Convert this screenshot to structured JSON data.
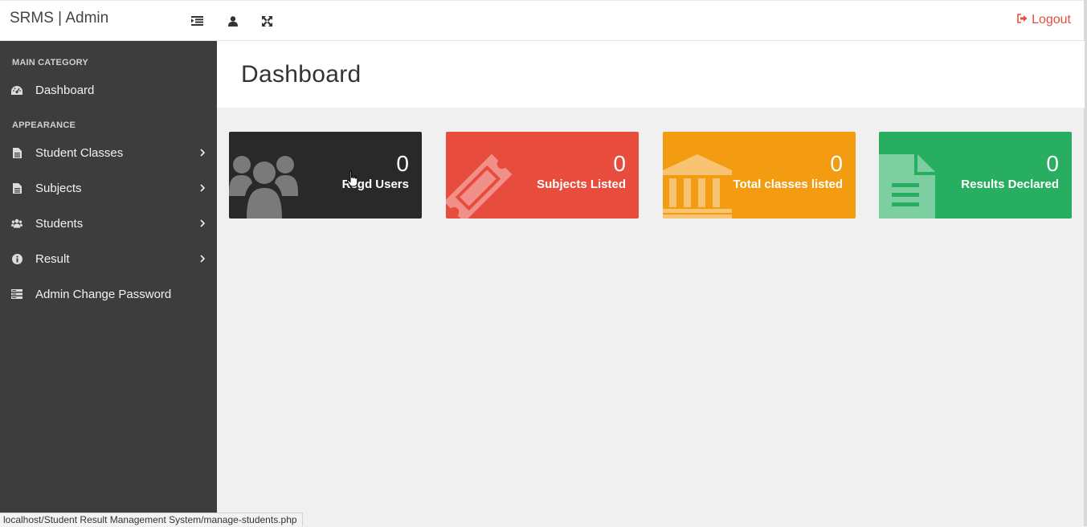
{
  "header": {
    "brand": "SRMS | Admin",
    "logout_label": "Logout",
    "icons": [
      "list-indent-icon",
      "user-icon",
      "expand-icon"
    ]
  },
  "sidebar": {
    "categories": [
      "MAIN CATEGORY",
      "APPEARANCE"
    ],
    "items": [
      {
        "label": "Dashboard",
        "icon": "dashboard-icon"
      },
      {
        "label": "Student Classes",
        "icon": "file-icon"
      },
      {
        "label": "Subjects",
        "icon": "file-icon"
      },
      {
        "label": "Students",
        "icon": "users-icon"
      },
      {
        "label": "Result",
        "icon": "info-icon"
      },
      {
        "label": "Admin Change Password",
        "icon": "server-icon"
      }
    ]
  },
  "main": {
    "title": "Dashboard",
    "cards": [
      {
        "value": "0",
        "label": "Regd Users",
        "color": "#292929",
        "icon": "users-icon"
      },
      {
        "value": "0",
        "label": "Subjects Listed",
        "color": "#e74c3c",
        "icon": "ticket-icon"
      },
      {
        "value": "0",
        "label": "Total classes listed",
        "color": "#f39c12",
        "icon": "bank-icon"
      },
      {
        "value": "0",
        "label": "Results Declared",
        "color": "#27ae60",
        "icon": "file-text-icon"
      }
    ]
  },
  "statusbar": {
    "url": "localhost/Student Result Management System/manage-students.php"
  },
  "colors": {
    "sidebar_bg": "#3d3d3d",
    "accent_red": "#e74c3c"
  }
}
